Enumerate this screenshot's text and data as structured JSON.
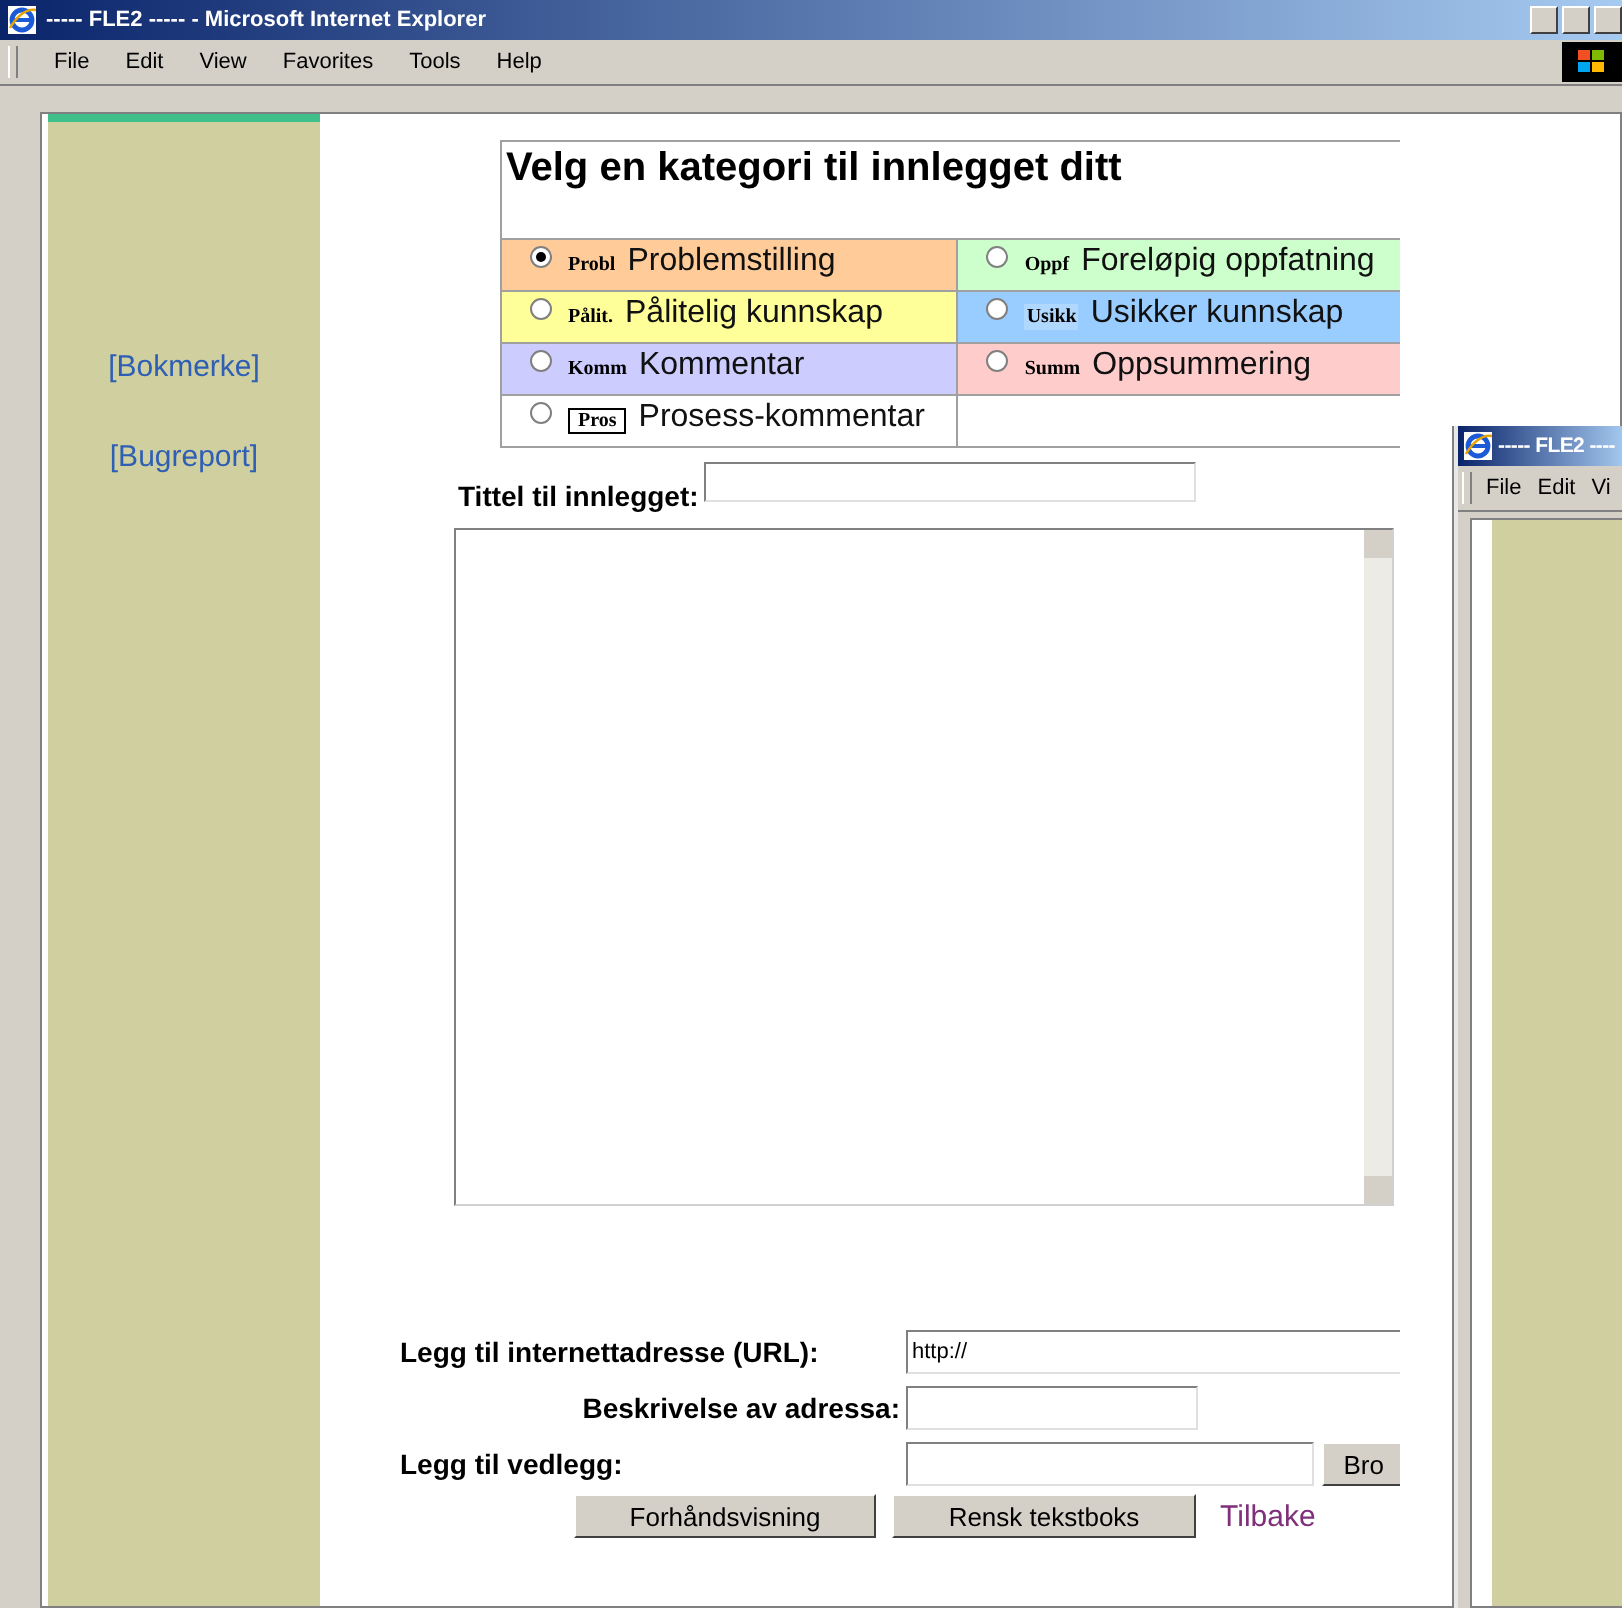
{
  "window": {
    "title": "----- FLE2 ----- - Microsoft Internet Explorer"
  },
  "menu": [
    "File",
    "Edit",
    "View",
    "Favorites",
    "Tools",
    "Help"
  ],
  "sidebar": {
    "links": [
      "[Bokmerke]",
      "[Bugreport]"
    ]
  },
  "category_table": {
    "heading": "Velg en kategori til innlegget ditt",
    "categories": [
      {
        "code": "Probl",
        "label": "Problemstilling",
        "selected": true,
        "color": "#ffcc99",
        "kind": "plain"
      },
      {
        "code": "Oppf",
        "label": "Foreløpig oppfatning",
        "selected": false,
        "color": "#ccffcc",
        "kind": "plain"
      },
      {
        "code": "Pålit.",
        "label": "Pålitelig kunnskap",
        "selected": false,
        "color": "#ffff99",
        "kind": "plain"
      },
      {
        "code": "Usikk",
        "label": "Usikker kunnskap",
        "selected": false,
        "color": "#99ccff",
        "kind": "highlight"
      },
      {
        "code": "Komm",
        "label": "Kommentar",
        "selected": false,
        "color": "#ccccff",
        "kind": "plain"
      },
      {
        "code": "Summ",
        "label": "Oppsummering",
        "selected": false,
        "color": "#ffcccc",
        "kind": "plain"
      },
      {
        "code": "Pros",
        "label": "Prosess-kommentar",
        "selected": false,
        "color": "#ffffff",
        "kind": "boxed"
      }
    ]
  },
  "title_field": {
    "label": "Tittel til innlegget:"
  },
  "form": {
    "url_label": "Legg til internettadresse (URL):",
    "url_value": "http://",
    "description_label": "Beskrivelse av adressa:",
    "attachment_label": "Legg til vedlegg:",
    "browse_button": "Bro",
    "buttons": [
      "Forhåndsvisning",
      "Rensk tekstboks"
    ],
    "back_link": "Tilbake"
  },
  "second_window": {
    "title": "----- FLE2 ----",
    "menu": [
      "File",
      "Edit",
      "Vi"
    ]
  }
}
